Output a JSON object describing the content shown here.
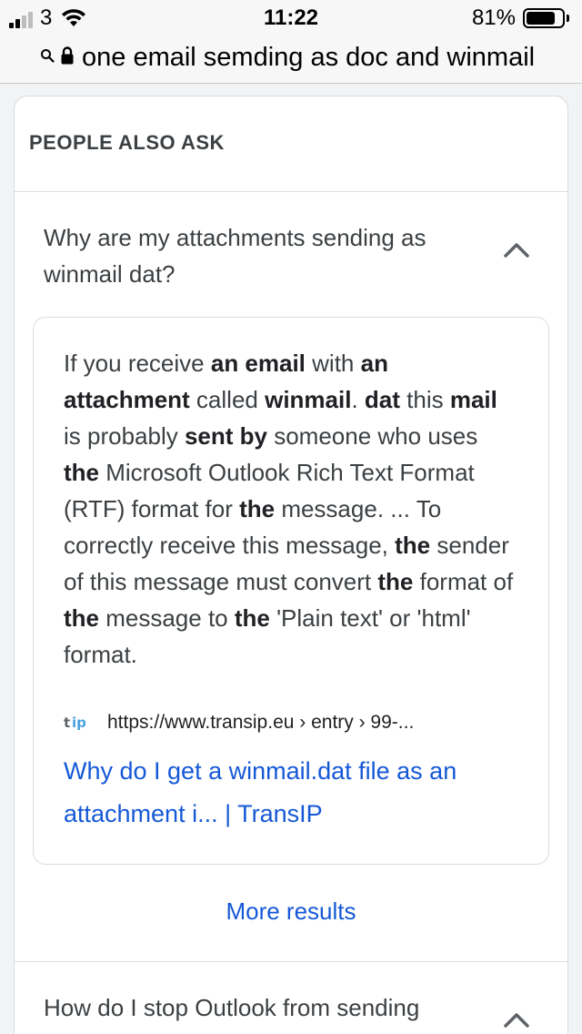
{
  "status_bar": {
    "carrier": "3",
    "time": "11:22",
    "battery_percent": "81%",
    "battery_level": 0.81,
    "signal_bars_active": 2,
    "signal_bars_total": 4,
    "icons": [
      "signal-icon",
      "wifi-icon",
      "battery-icon"
    ]
  },
  "url_bar": {
    "query": "one email semding as doc and winmail",
    "icons": [
      "search-icon",
      "lock-icon"
    ]
  },
  "people_also_ask": {
    "header": "PEOPLE ALSO ASK",
    "questions": [
      {
        "text": "Why are my attachments sending as winmail dat?",
        "expanded": true,
        "answer": {
          "segments": [
            {
              "t": "If you receive ",
              "b": false
            },
            {
              "t": "an email",
              "b": true
            },
            {
              "t": " with ",
              "b": false
            },
            {
              "t": "an attachment",
              "b": true
            },
            {
              "t": " called ",
              "b": false
            },
            {
              "t": "winmail",
              "b": true
            },
            {
              "t": ". ",
              "b": false
            },
            {
              "t": "dat",
              "b": true
            },
            {
              "t": " this ",
              "b": false
            },
            {
              "t": "mail",
              "b": true
            },
            {
              "t": " is probably ",
              "b": false
            },
            {
              "t": "sent by",
              "b": true
            },
            {
              "t": " someone who uses ",
              "b": false
            },
            {
              "t": "the",
              "b": true
            },
            {
              "t": " Microsoft Outlook Rich Text Format (RTF) format for ",
              "b": false
            },
            {
              "t": "the",
              "b": true
            },
            {
              "t": " message. ... To correctly receive this message, ",
              "b": false
            },
            {
              "t": "the",
              "b": true
            },
            {
              "t": " sender of this message must convert ",
              "b": false
            },
            {
              "t": "the",
              "b": true
            },
            {
              "t": " format of ",
              "b": false
            },
            {
              "t": "the",
              "b": true
            },
            {
              "t": " message to ",
              "b": false
            },
            {
              "t": "the",
              "b": true
            },
            {
              "t": " 'Plain text' or 'html' format.",
              "b": false
            }
          ],
          "source_favicon": "transip-favicon-icon",
          "source_url": "https://www.transip.eu › entry › 99-...",
          "link_title": "Why do I get a winmail.dat file as an attachment i... | TransIP"
        }
      },
      {
        "text": "How do I stop Outlook from sending",
        "expanded": false
      }
    ],
    "more_results": "More results"
  },
  "colors": {
    "link": "#1558d6",
    "text": "#3c4043",
    "border": "#dadce0",
    "background": "#f1f3f4"
  }
}
